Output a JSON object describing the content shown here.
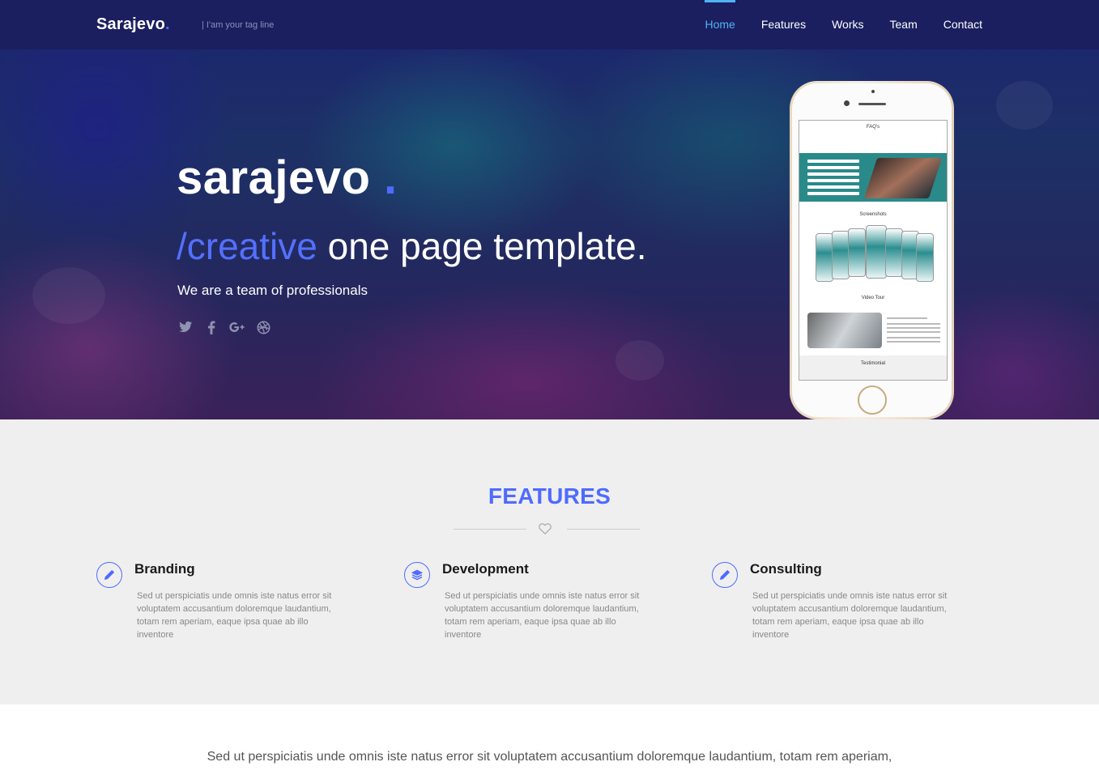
{
  "navbar": {
    "brand": "Sarajevo",
    "brand_dot": ".",
    "tagline": "| I'am your tag line",
    "items": [
      {
        "label": "Home",
        "active": true
      },
      {
        "label": "Features",
        "active": false
      },
      {
        "label": "Works",
        "active": false
      },
      {
        "label": "Team",
        "active": false
      },
      {
        "label": "Contact",
        "active": false
      }
    ]
  },
  "hero": {
    "title": "sarajevo",
    "title_dot": ".",
    "subtitle_accent": "/creative",
    "subtitle_rest": "one page template.",
    "text": "We are a team of professionals",
    "socials": [
      "twitter-icon",
      "facebook-icon",
      "google-plus-icon",
      "dribbble-icon"
    ]
  },
  "phone_screen": {
    "section1": "FAQ's",
    "section2": "Screenshots",
    "section3": "Video Tour",
    "section4": "Testimonial"
  },
  "features": {
    "title": "FEATURES",
    "items": [
      {
        "title": "Branding",
        "icon": "pencil-icon",
        "text": "Sed ut perspiciatis unde omnis iste natus error sit voluptatem accusantium doloremque laudantium, totam rem aperiam, eaque ipsa quae ab illo inventore"
      },
      {
        "title": "Development",
        "icon": "layers-icon",
        "text": "Sed ut perspiciatis unde omnis iste natus error sit voluptatem accusantium doloremque laudantium, totam rem aperiam, eaque ipsa quae ab illo inventore"
      },
      {
        "title": "Consulting",
        "icon": "pencil-icon",
        "text": "Sed ut perspiciatis unde omnis iste natus error sit voluptatem accusantium doloremque laudantium, totam rem aperiam, eaque ipsa quae ab illo inventore"
      }
    ]
  },
  "bottom": {
    "text": "Sed ut perspiciatis unde omnis iste natus error sit voluptatem accusantium doloremque laudantium, totam rem aperiam,"
  },
  "colors": {
    "accent": "#4f6bff",
    "nav_bg": "#1b1f5f",
    "nav_active": "#4fb3f6",
    "features_bg": "#efefef"
  }
}
